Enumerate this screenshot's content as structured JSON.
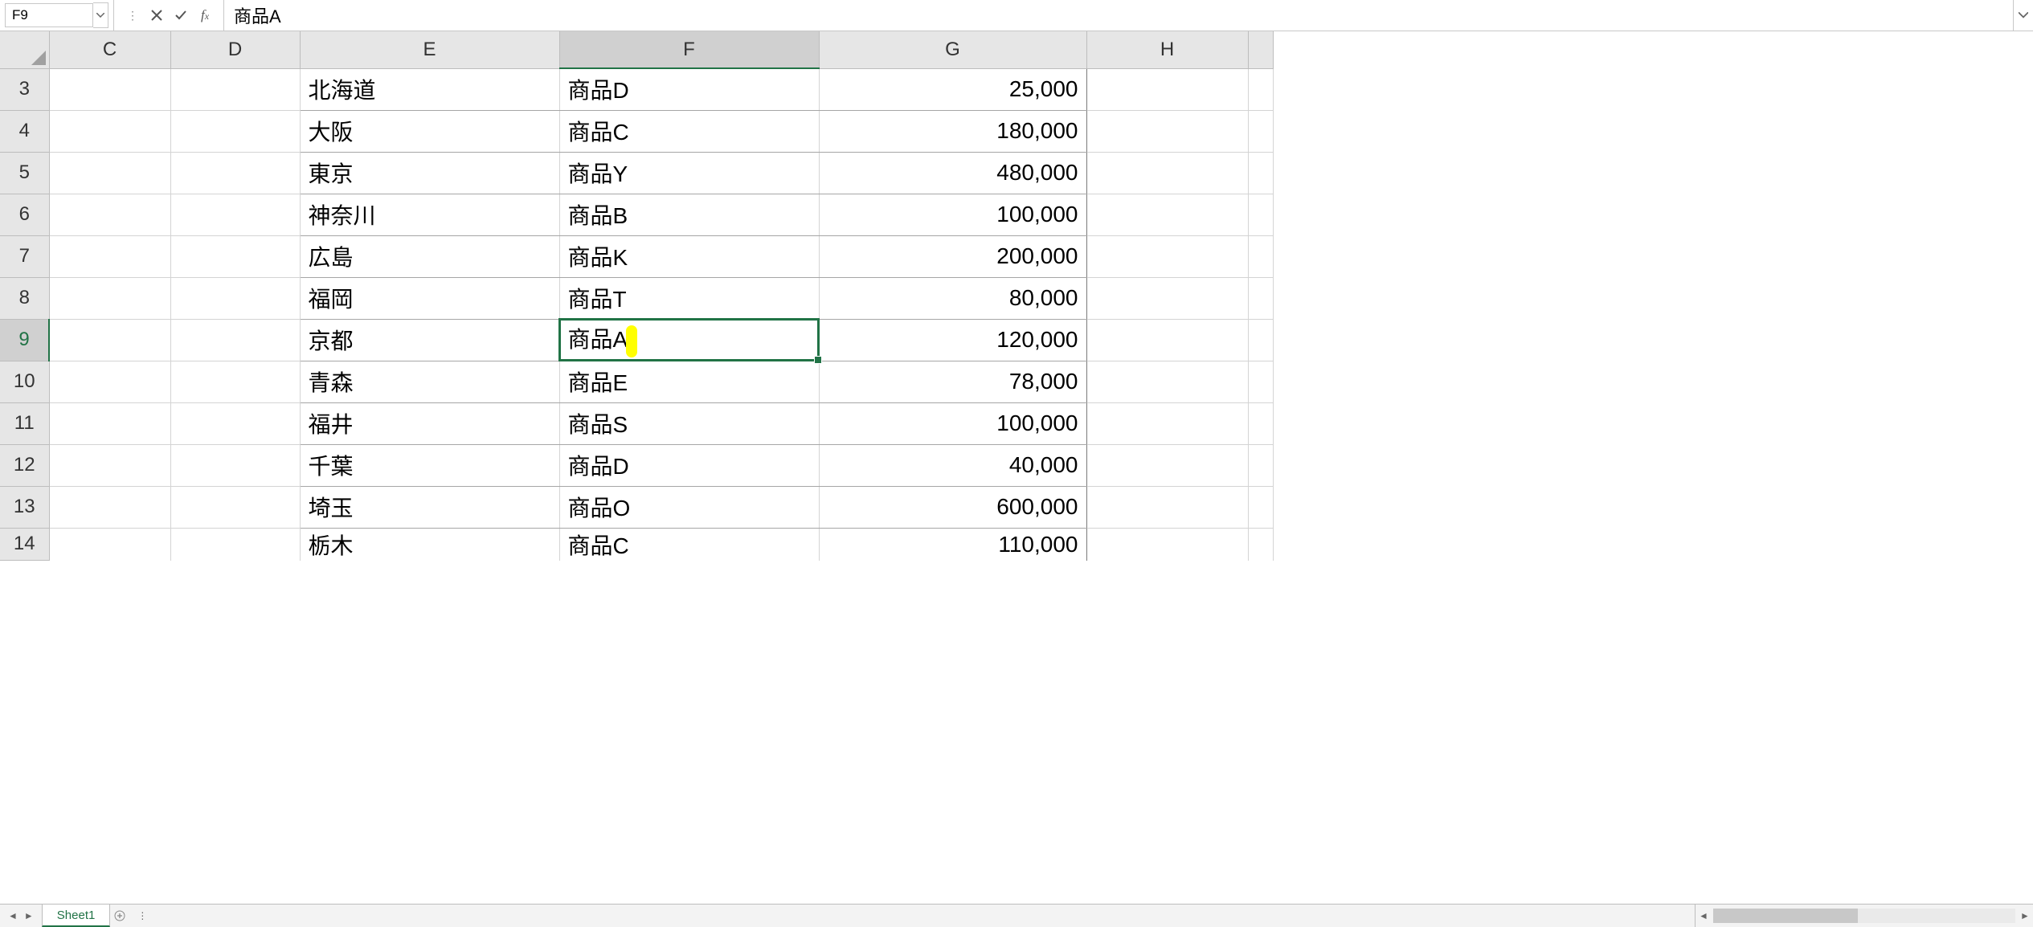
{
  "namebox": "F9",
  "formula_input": "商品A",
  "columns": [
    "C",
    "D",
    "E",
    "F",
    "G",
    "H",
    ""
  ],
  "selected_col_index": 3,
  "selected_row_index": 6,
  "rows": [
    {
      "num": "3",
      "E": "北海道",
      "F": "商品D",
      "G": "25,000"
    },
    {
      "num": "4",
      "E": "大阪",
      "F": "商品C",
      "G": "180,000"
    },
    {
      "num": "5",
      "E": "東京",
      "F": "商品Y",
      "G": "480,000"
    },
    {
      "num": "6",
      "E": "神奈川",
      "F": "商品B",
      "G": "100,000"
    },
    {
      "num": "7",
      "E": "広島",
      "F": "商品K",
      "G": "200,000"
    },
    {
      "num": "8",
      "E": "福岡",
      "F": "商品T",
      "G": "80,000"
    },
    {
      "num": "9",
      "E": "京都",
      "F": "商品A",
      "G": "120,000"
    },
    {
      "num": "10",
      "E": "青森",
      "F": "商品E",
      "G": "78,000"
    },
    {
      "num": "11",
      "E": "福井",
      "F": "商品S",
      "G": "100,000"
    },
    {
      "num": "12",
      "E": "千葉",
      "F": "商品D",
      "G": "40,000"
    },
    {
      "num": "13",
      "E": "埼玉",
      "F": "商品O",
      "G": "600,000"
    },
    {
      "num": "14",
      "E": "栃木",
      "F": "商品C",
      "G": "110,000"
    }
  ],
  "sheet_tab": "Sheet1"
}
